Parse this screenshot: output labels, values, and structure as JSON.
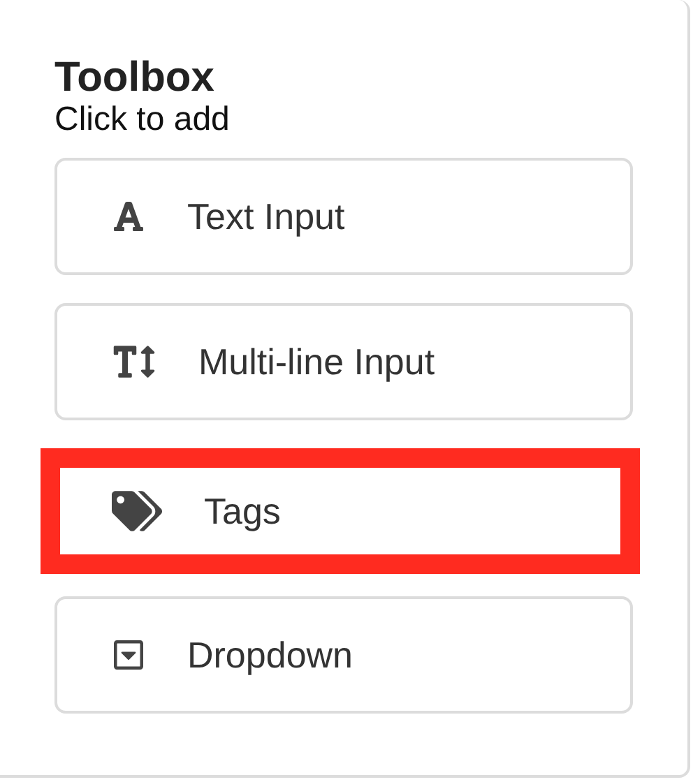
{
  "toolbox": {
    "title": "Toolbox",
    "subtitle": "Click to add",
    "items": [
      {
        "kind": "text",
        "label": "Text Input",
        "highlighted": false
      },
      {
        "kind": "multiline",
        "label": "Multi-line Input",
        "highlighted": false
      },
      {
        "kind": "tags",
        "label": "Tags",
        "highlighted": true
      },
      {
        "kind": "dropdown",
        "label": "Dropdown",
        "highlighted": false
      }
    ]
  }
}
